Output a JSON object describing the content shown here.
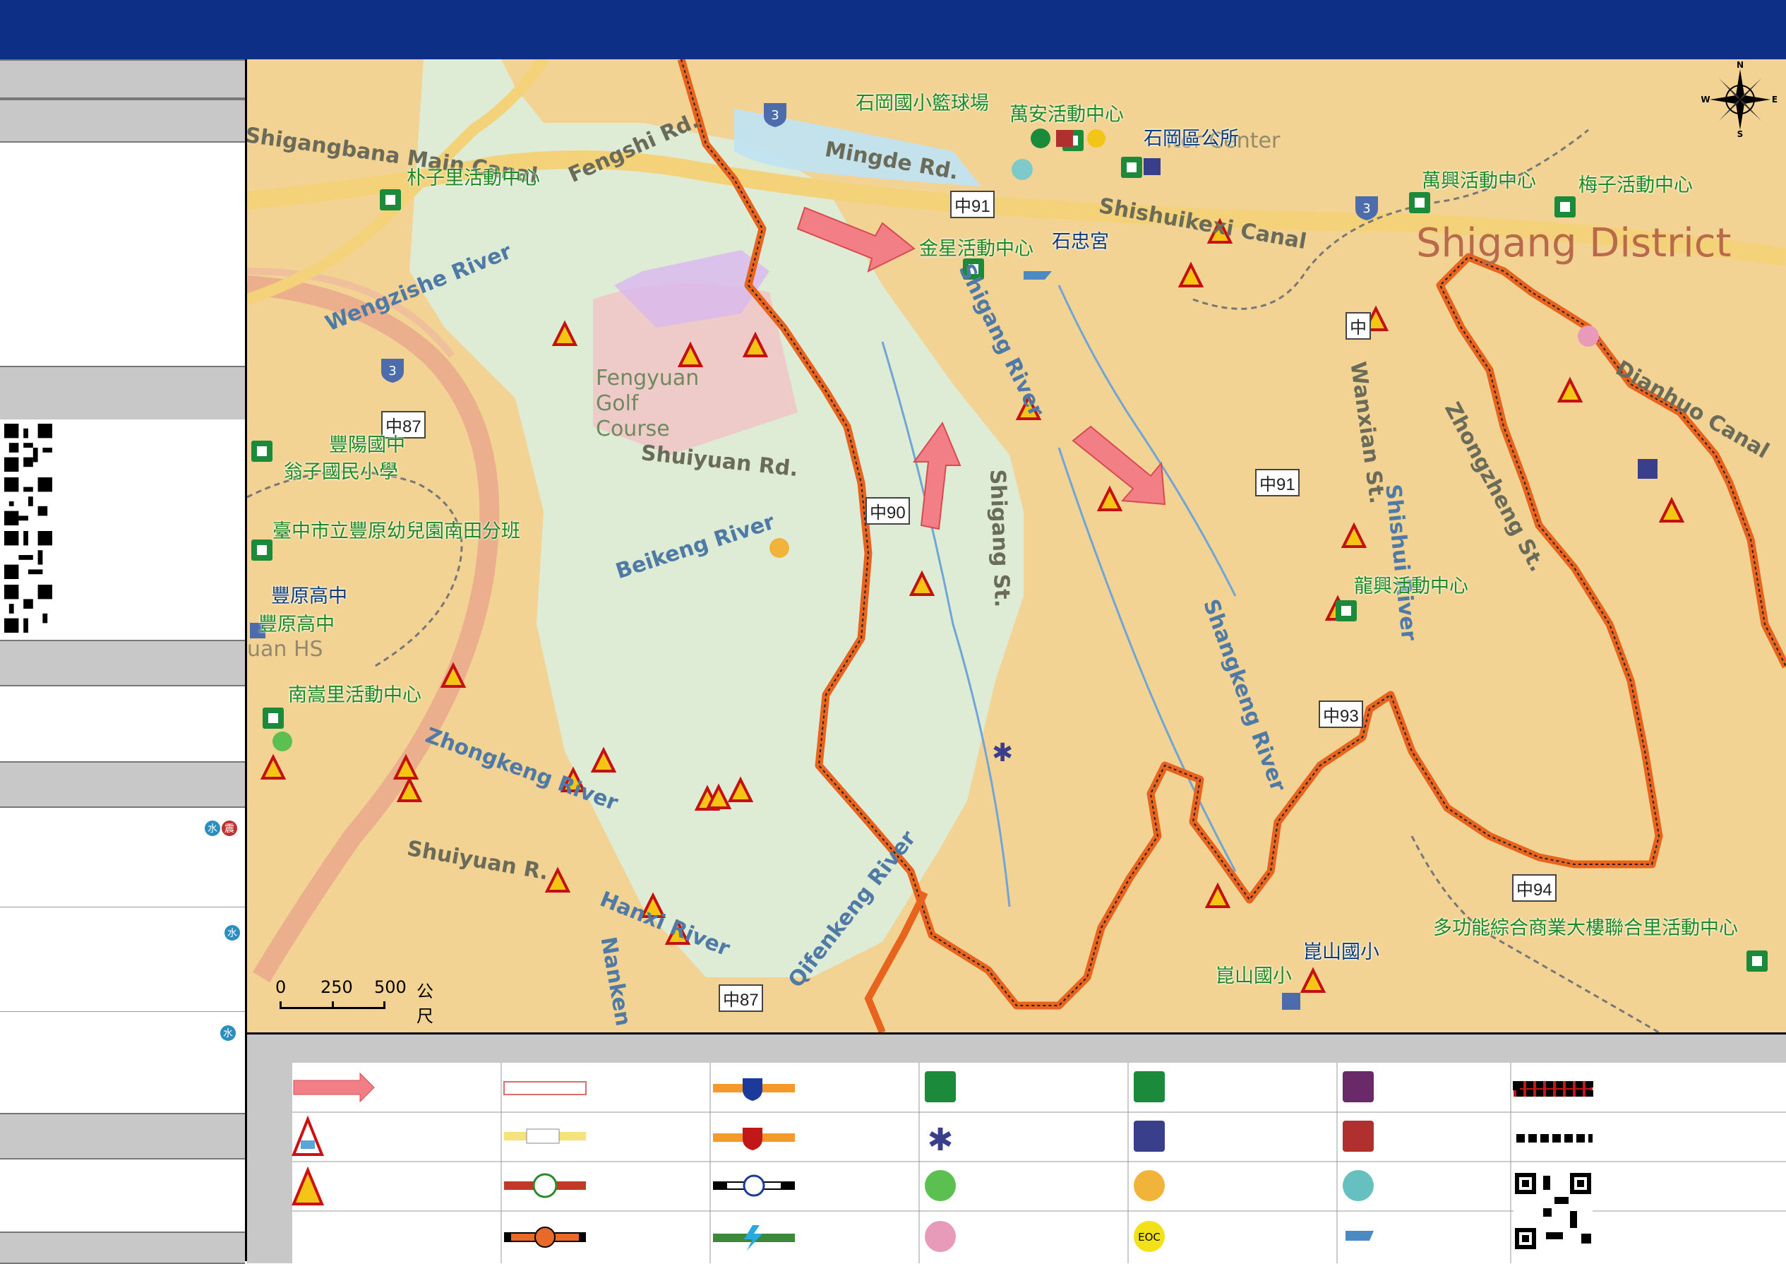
{
  "map": {
    "labels_green": [
      {
        "text": "石岡國小籃球場"
      },
      {
        "text": "萬安活動中心"
      },
      {
        "text": "朴子里活動中心"
      },
      {
        "text": "金星活動中心"
      },
      {
        "text": "萬興活動中心"
      },
      {
        "text": "梅子活動中心"
      },
      {
        "text": "豐陽國中"
      },
      {
        "text": "翁子國民小學"
      },
      {
        "text": "臺中市立豐原幼兒園南田分班"
      },
      {
        "text": "豐原高中"
      },
      {
        "text": "南嵩里活動中心"
      },
      {
        "text": "龍興活動中心"
      },
      {
        "text": "多功能綜合商業大樓聯合里活動中心"
      },
      {
        "text": "崑山國小"
      }
    ],
    "labels_blue": [
      {
        "text": "石岡區公所"
      },
      {
        "text": "石忠宮"
      },
      {
        "text": "豐原高中"
      },
      {
        "text": "崑山國小"
      }
    ],
    "roads": [
      {
        "text": "Fengshi Rd."
      },
      {
        "text": "Mingde Rd."
      },
      {
        "text": "Shuiyuan Rd."
      },
      {
        "text": "Shigang St."
      },
      {
        "text": "Wanxian St."
      },
      {
        "text": "Zhongzheng St."
      },
      {
        "text": "Shuiyuan R."
      },
      {
        "text": "Shigangbana Main Canal"
      },
      {
        "text": "Shishuikexi Canal"
      },
      {
        "text": "Dianhuo Canal"
      },
      {
        "text": "itor Center"
      },
      {
        "text": "uan HS"
      }
    ],
    "rivers": [
      {
        "text": "Wengzishe River"
      },
      {
        "text": "Beikeng River"
      },
      {
        "text": "Zhongkeng River"
      },
      {
        "text": "Shangkeng River"
      },
      {
        "text": "Qifenkeng River"
      },
      {
        "text": "Hanxi River"
      },
      {
        "text": "Nanken"
      },
      {
        "text": "Shishui River"
      },
      {
        "text": "Shigang River"
      }
    ],
    "district": "Shigang District",
    "golf": "Fengyuan Golf Course",
    "shields": [
      {
        "text": "中91"
      },
      {
        "text": "中91"
      },
      {
        "text": "中90"
      },
      {
        "text": "中87"
      },
      {
        "text": "中87"
      },
      {
        "text": "中93"
      },
      {
        "text": "中94"
      },
      {
        "text": "中"
      }
    ],
    "highway_shields": [
      {
        "text": "3"
      },
      {
        "text": "3"
      },
      {
        "text": "3"
      }
    ],
    "scalebar": {
      "t0": "0",
      "t1": "250",
      "t2": "500",
      "unit": "公尺"
    },
    "compass": {
      "n": "N",
      "s": "S",
      "e": "E",
      "w": "W"
    }
  },
  "sidebar": {
    "badges": [
      {
        "text": "水",
        "color": "#2a8fc0"
      },
      {
        "text": "震",
        "color": "#c03030"
      },
      {
        "text": "水",
        "color": "#2a8fc0"
      },
      {
        "text": "水",
        "color": "#2a8fc0"
      }
    ]
  },
  "legend": {
    "eoc_label": "EOC"
  }
}
